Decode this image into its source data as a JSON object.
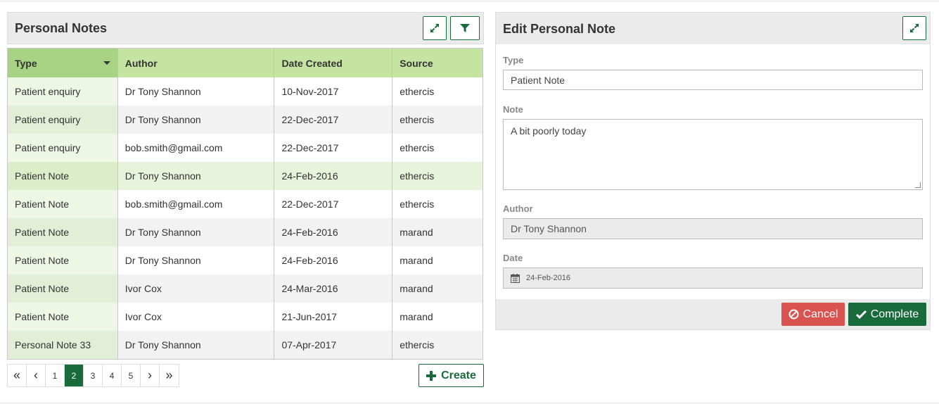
{
  "left_panel": {
    "title": "Personal Notes",
    "expand_icon": "expand-icon",
    "filter_icon": "filter-icon",
    "columns": [
      "Type",
      "Author",
      "Date Created",
      "Source"
    ],
    "sorted_column": "Type",
    "rows": [
      {
        "type": "Patient enquiry",
        "author": "Dr Tony Shannon",
        "date": "10-Nov-2017",
        "source": "ethercis"
      },
      {
        "type": "Patient enquiry",
        "author": "Dr Tony Shannon",
        "date": "22-Dec-2017",
        "source": "ethercis"
      },
      {
        "type": "Patient enquiry",
        "author": "bob.smith@gmail.com",
        "date": "22-Dec-2017",
        "source": "ethercis"
      },
      {
        "type": "Patient Note",
        "author": "Dr Tony Shannon",
        "date": "24-Feb-2016",
        "source": "ethercis"
      },
      {
        "type": "Patient Note",
        "author": "bob.smith@gmail.com",
        "date": "22-Dec-2017",
        "source": "ethercis"
      },
      {
        "type": "Patient Note",
        "author": "Dr Tony Shannon",
        "date": "24-Feb-2016",
        "source": "marand"
      },
      {
        "type": "Patient Note",
        "author": "Dr Tony Shannon",
        "date": "24-Feb-2016",
        "source": "marand"
      },
      {
        "type": "Patient Note",
        "author": "Ivor Cox",
        "date": "24-Mar-2016",
        "source": "marand"
      },
      {
        "type": "Patient Note",
        "author": "Ivor Cox",
        "date": "21-Jun-2017",
        "source": "marand"
      },
      {
        "type": "Personal Note 33",
        "author": "Dr Tony Shannon",
        "date": "07-Apr-2017",
        "source": "ethercis"
      }
    ],
    "selected_row": 3,
    "pagination": {
      "first": "«",
      "prev": "‹",
      "next": "›",
      "last": "»",
      "pages": [
        "1",
        "2",
        "3",
        "4",
        "5"
      ],
      "current": "2"
    },
    "create_label": "Create"
  },
  "right_panel": {
    "title": "Edit Personal Note",
    "expand_icon": "expand-icon",
    "type_label": "Type",
    "type_value": "Patient Note",
    "note_label": "Note",
    "note_value": "A bit poorly today",
    "author_label": "Author",
    "author_value": "Dr Tony Shannon",
    "date_label": "Date",
    "date_value": "24-Feb-2016",
    "cancel_label": "Cancel",
    "complete_label": "Complete"
  },
  "colors": {
    "accent": "#1a6b3c",
    "table_header": "#c5e3a1",
    "cancel": "#d9534f"
  }
}
